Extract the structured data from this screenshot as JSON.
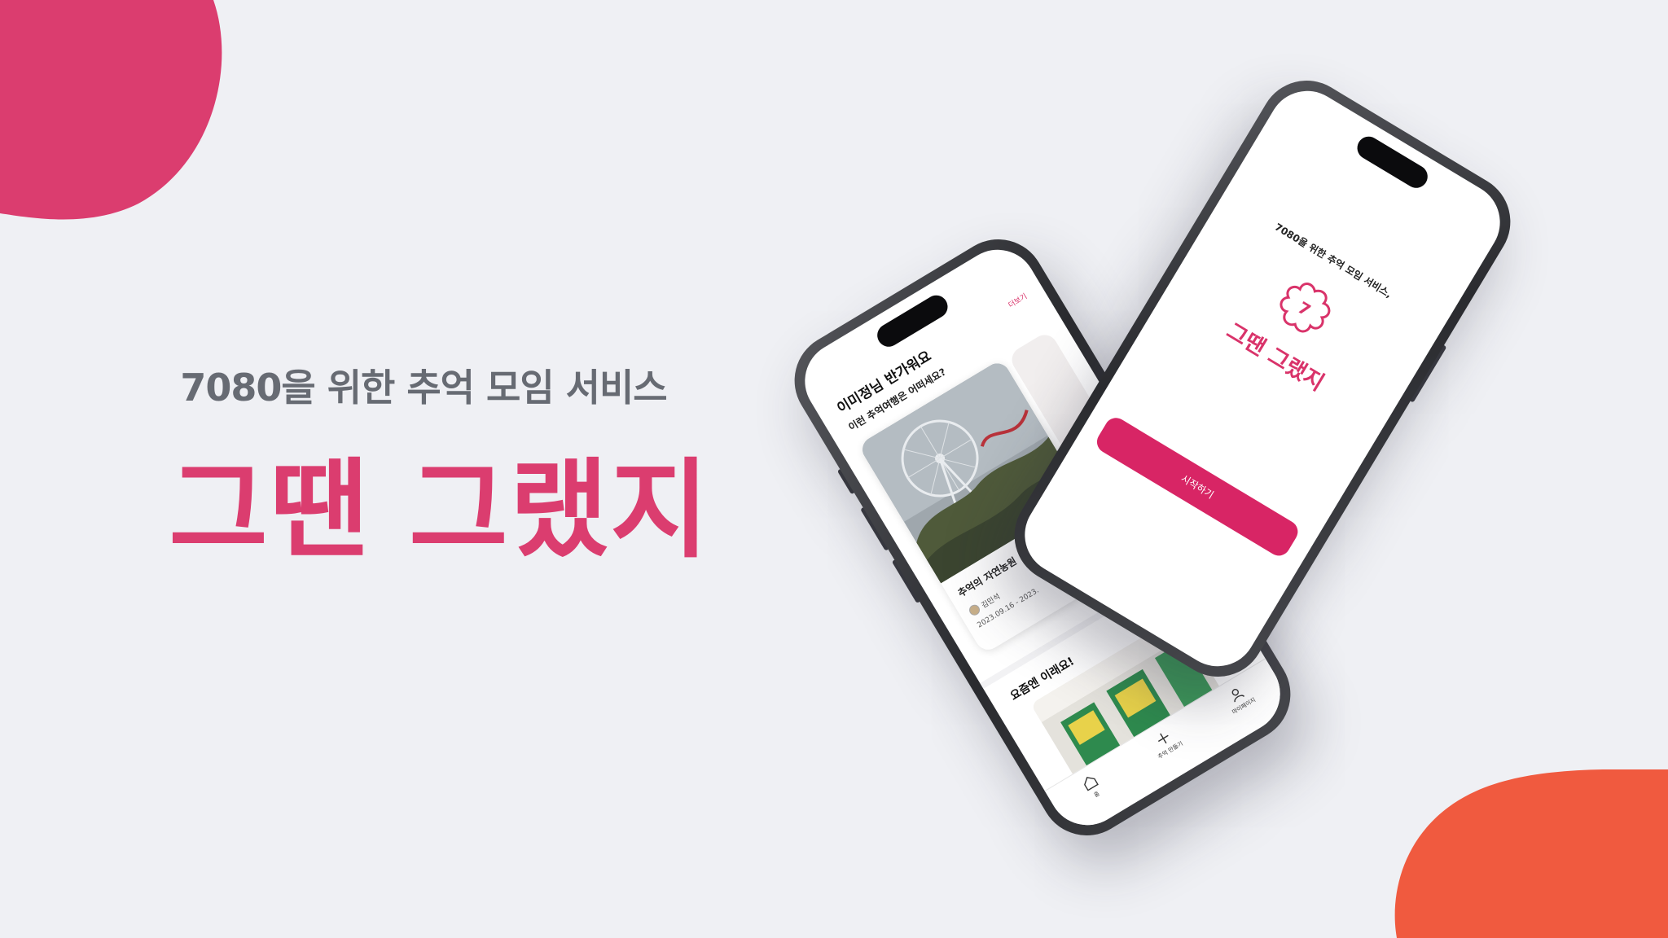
{
  "colors": {
    "background": "#eff0f4",
    "accent_pink": "#db3d6f",
    "accent_orange": "#f05a3f",
    "subtitle_gray": "#676b73"
  },
  "hero": {
    "subtitle": "7080을 위한 추억 모임 서비스",
    "title": "그땐 그랬지"
  },
  "home_screen": {
    "greeting": "이미정님 반가워요",
    "see_more": "더보기",
    "question": "이런 추억여행은 어떠세요?",
    "card": {
      "title": "추억의 자연농원",
      "author": "김민석",
      "date": "2023.09.16 - 2023."
    },
    "see_more_2": "더보",
    "section2_title": "요즘엔 이래요!",
    "tabs": [
      {
        "label": "홈",
        "icon": "home-icon"
      },
      {
        "label": "추억 만들기",
        "icon": "plus-icon"
      },
      {
        "label": "마이페이지",
        "icon": "person-icon"
      }
    ]
  },
  "splash_screen": {
    "intro": "7080을 위한 추억 모임 서비스,",
    "logo_text": "7",
    "brand": "그땐 그랬지",
    "start_button": "시작하기"
  }
}
